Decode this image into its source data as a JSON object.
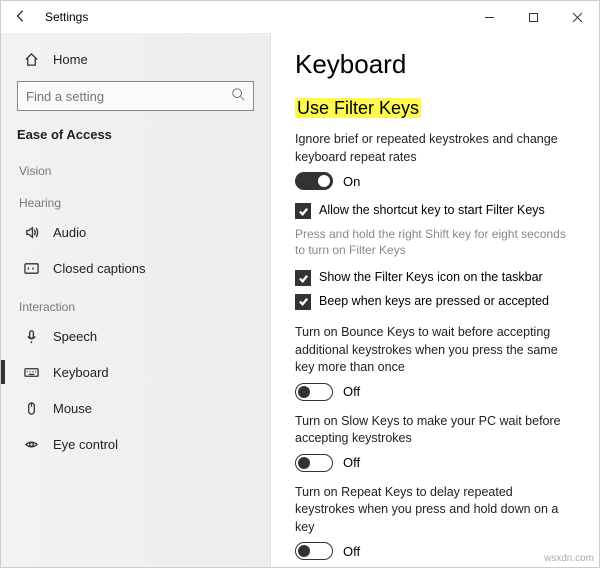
{
  "titlebar": {
    "title": "Settings"
  },
  "sidebar": {
    "home": "Home",
    "search_placeholder": "Find a setting",
    "section": "Ease of Access",
    "groups": {
      "vision": "Vision",
      "hearing": "Hearing",
      "interaction": "Interaction"
    },
    "items": {
      "audio": "Audio",
      "closed_captions": "Closed captions",
      "speech": "Speech",
      "keyboard": "Keyboard",
      "mouse": "Mouse",
      "eye_control": "Eye control"
    }
  },
  "content": {
    "page_title": "Keyboard",
    "filter_heading": "Use Filter Keys",
    "filter_desc": "Ignore brief or repeated keystrokes and change keyboard repeat rates",
    "filter_toggle": "On",
    "cb_shortcut": "Allow the shortcut key to start Filter Keys",
    "cb_shortcut_sub": "Press and hold the right Shift key for eight seconds to turn on Filter Keys",
    "cb_icon": "Show the Filter Keys icon on the taskbar",
    "cb_beep": "Beep when keys are pressed or accepted",
    "bounce_desc": "Turn on Bounce Keys to wait before accepting additional keystrokes when you press the same key more than once",
    "bounce_toggle": "Off",
    "slow_desc": "Turn on Slow Keys to make your PC wait before accepting keystrokes",
    "slow_toggle": "Off",
    "repeat_desc": "Turn on Repeat Keys to delay repeated keystrokes when you press and hold down on a key",
    "repeat_toggle": "Off"
  },
  "watermark": "wsxdn.com"
}
